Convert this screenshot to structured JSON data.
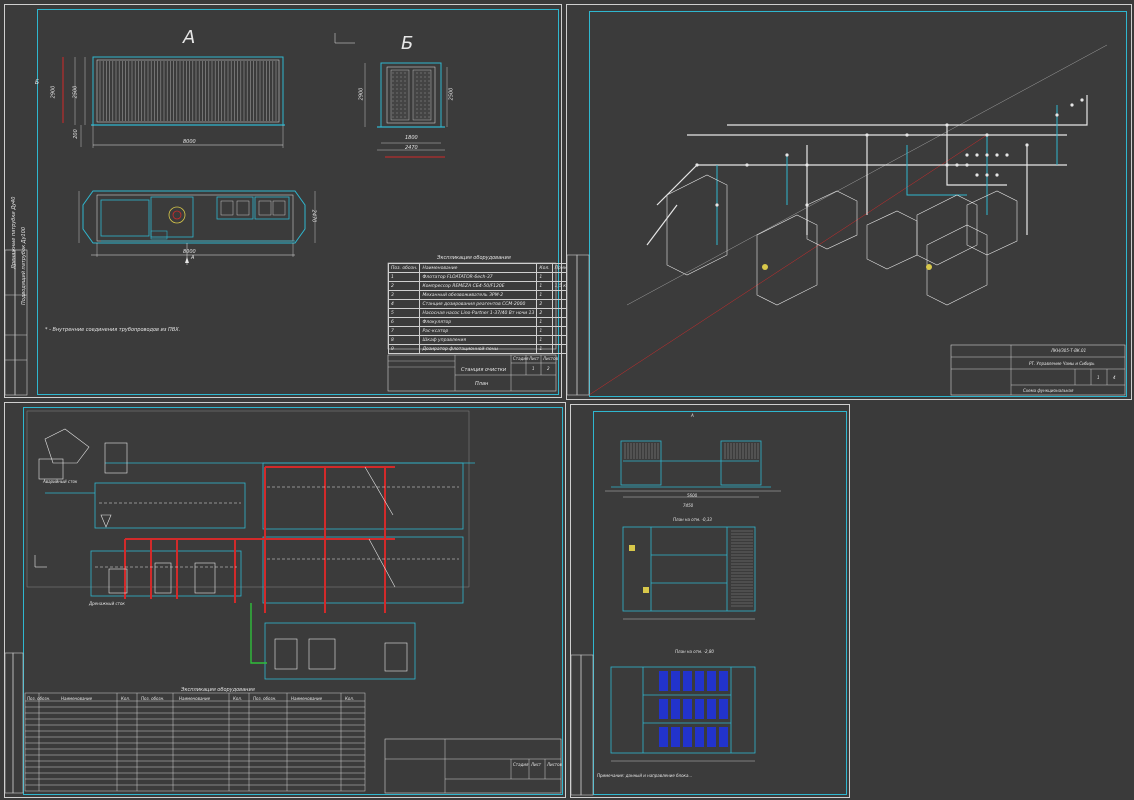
{
  "sheet1": {
    "view_a_label": "А",
    "view_b_label": "Б",
    "section_marker": "Б",
    "dim_8000_top": "8000",
    "dim_8000_bottom": "8000",
    "dim_2900": "2900",
    "dim_2500": "2500",
    "dim_200": "200",
    "dim_1800": "1800",
    "dim_2470": "2470",
    "dim_2500_b": "2500",
    "dim_2900_b": "2900",
    "dim_2470_plan": "2470",
    "plan_arrow_label": "А",
    "vertical_note_1": "Дренажные патрубки Ду40",
    "vertical_note_2": "Подводящий патрубок Ду100",
    "footnote": "* - Внутренние соединения трубопроводов из ПВХ.",
    "spec_title": "Экспликация оборудования",
    "spec_headers": [
      "Поз. обозн.",
      "Наименование",
      "Кол.",
      "Примечание"
    ],
    "spec_rows": [
      [
        "1",
        "Флотатор FLOATATOR-6ech-37",
        "1",
        ""
      ],
      [
        "2",
        "Компрессор REMEZA СБ4-50/F120Е",
        "1",
        "1,5 кВт"
      ],
      [
        "3",
        "Механный обезвоживатель ЗРМ-2",
        "1",
        ""
      ],
      [
        "4",
        "Станция дозирования реагентов ССМ-2000",
        "2",
        ""
      ],
      [
        "5",
        "Насосная насос Lino-Partner 1-37/40 Вт ночи 13",
        "2",
        ""
      ],
      [
        "6",
        "Флокулятор",
        "1",
        ""
      ],
      [
        "7",
        "Рас-ксатор",
        "1",
        ""
      ],
      [
        "8",
        "Шкаф управления",
        "1",
        ""
      ],
      [
        "9",
        "Дозиратор флотационной пены",
        "1",
        ""
      ]
    ],
    "title_block_name": "Станция очистки",
    "title_block_sheet": "План",
    "tb_col_stage": "Стадия",
    "tb_col_sheet": "Лист",
    "tb_col_sheets": "Листов",
    "tb_sheet_no": "1",
    "tb_sheets": "2"
  },
  "sheet2": {
    "doc_code": "ЛКН/З05-Т-ВК.01",
    "doc_title": "РТ. Управление Чамы и Сибирь",
    "tb_sheet_no": "1",
    "tb_sheets": "4",
    "sheet_name": "Схема функциональная"
  },
  "sheet3": {
    "label_overflow": "Аварийный сток",
    "label_drain": "Дренажный сток",
    "spec_title": "Экспликация оборудования",
    "spec_headers": [
      "Поз. обозн.",
      "Наименование",
      "Кол.",
      "Поз. обозн.",
      "Наименование",
      "Кол.",
      "Поз. обозн.",
      "Наименование",
      "Кол."
    ],
    "col_stage": "Стадия",
    "col_sheet": "Лист",
    "col_sheets": "Листов"
  },
  "sheet4": {
    "label_a": "А",
    "plan_1": "План на отм. -0,33",
    "plan_2": "План на отм. -2,80",
    "dim_5600": "5600",
    "dim_7450": "7450",
    "notes": "Примечание: данный и направление блока..."
  },
  "colors": {
    "line_cyan": "#2fb7cf",
    "line_white": "#e6e6e6",
    "line_red": "#d22a2a",
    "line_green": "#2fbf3a",
    "fill_blue": "#2233cc",
    "fill_yellow": "#d8c84a",
    "background": "#3b3b3b"
  }
}
